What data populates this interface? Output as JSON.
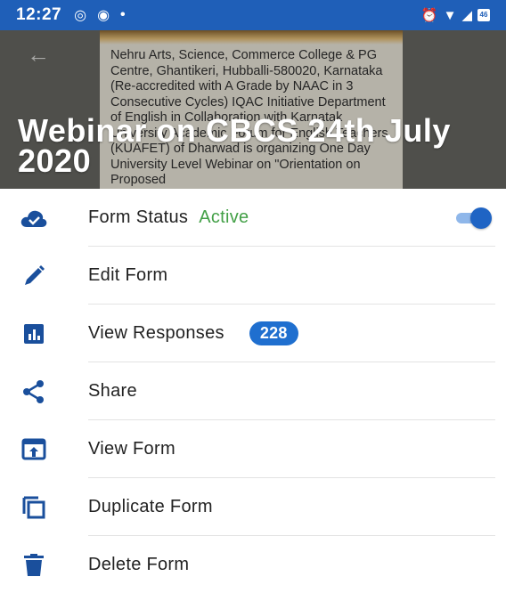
{
  "status_bar": {
    "time": "12:27",
    "left_icons": [
      "alarm-sync-icon",
      "chat-icon",
      "dot-icon"
    ],
    "right_icons": [
      "alarm-clock-icon",
      "wifi-icon",
      "signal-icon",
      "battery-icon"
    ],
    "battery_text": "46"
  },
  "header": {
    "poster_text": "Nehru Arts, Science, Commerce College & PG Centre, Ghantikeri, Hubballi-580020, Karnataka (Re-accredited with A Grade by NAAC in 3 Consecutive Cycles) IQAC Initiative Department of English in Collaboration with Karnatak University Academic Forum for English Teachers (KUAFET) of Dharwad is organizing One Day University Level Webinar on \"Orientation on Proposed",
    "title": "Webinar on CBCS 24th July 2020"
  },
  "menu": {
    "form_status": {
      "label": "Form Status",
      "value": "Active",
      "enabled": true
    },
    "edit_form": {
      "label": "Edit Form"
    },
    "view_responses": {
      "label": "View Responses",
      "count": "228"
    },
    "share": {
      "label": "Share"
    },
    "view_form": {
      "label": "View Form"
    },
    "duplicate_form": {
      "label": "Duplicate Form"
    },
    "delete_form": {
      "label": "Delete Form"
    }
  },
  "colors": {
    "primary": "#1f5fb8",
    "icon": "#1a4f9c",
    "active_green": "#43a047",
    "badge": "#1f6fcf"
  }
}
